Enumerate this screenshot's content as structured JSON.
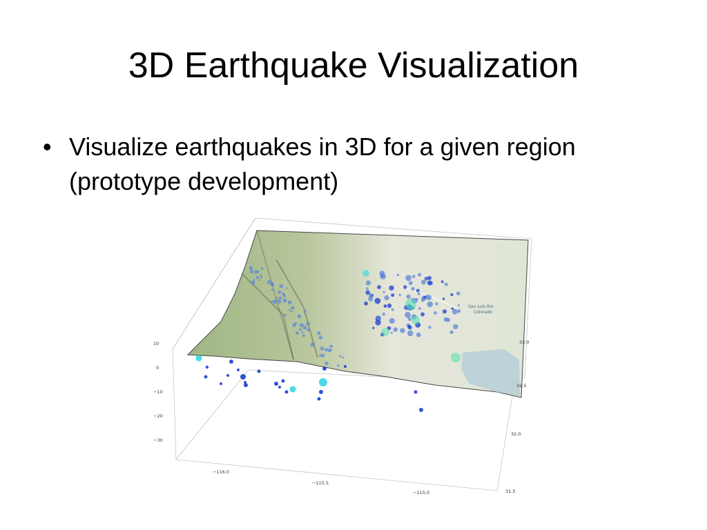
{
  "slide": {
    "title": "3D Earthquake Visualization",
    "bullets": [
      {
        "marker": "•",
        "text": "Visualize earthquakes in 3D for a given region (prototype development)"
      }
    ]
  },
  "figure": {
    "depth_axis_ticks": [
      "10",
      "0",
      "−10",
      "−20",
      "−30"
    ],
    "longitude_axis_ticks": [
      "−116.0",
      "−115.5",
      "−115.0"
    ],
    "latitude_axis_ticks": [
      "33.0",
      "32.5",
      "32.0",
      "31.5"
    ],
    "map_labels": [
      "San Luis Rio",
      "Colorado"
    ],
    "colors": {
      "terrain_green": "#a9bf8e",
      "terrain_light": "#dde3cf",
      "water": "#b9cfd9",
      "quake_dark": "#1b3fd0",
      "quake_mid": "#5d86d8",
      "quake_cyan": "#36d6e6",
      "quake_teal": "#59e3b0"
    }
  }
}
